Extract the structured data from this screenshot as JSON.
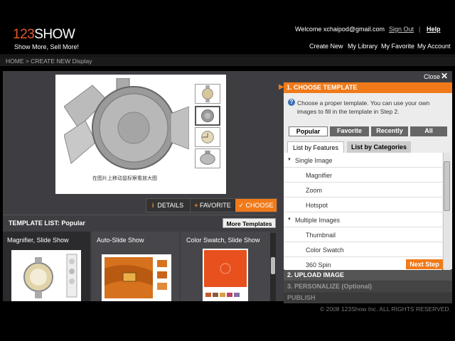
{
  "header": {
    "logo_num": "123",
    "logo_text": "SHOW",
    "tagline": "Show More, Sell More!",
    "welcome": "Welcome xchaipod@gmail.com",
    "sign_out": "Sign Out",
    "separator": "|",
    "help": "Help",
    "nav": [
      "Create New",
      "My Library",
      "My Favorite",
      "My Account"
    ]
  },
  "breadcrumb": "HOME > CREATE NEW Display",
  "preview": {
    "caption": "在图片上移动鼠标察看放大图"
  },
  "actions": {
    "details_icon": "i",
    "details": "DETAILS",
    "favorite_icon": "+",
    "favorite": "FAVORITE",
    "choose_icon": "✓",
    "choose": "CHOOSE"
  },
  "template_list": {
    "title": "TEMPLATE LIST: Popular",
    "more": "More Templates",
    "items": [
      "Magnifier, Slide Show",
      "Auto-Slide Show",
      "Color Swatch, Slide Show"
    ]
  },
  "right_panel": {
    "close": "Close",
    "close_icon": "✕",
    "step_arrow": "▶",
    "step1": "1. CHOOSE TEMPLATE",
    "info_icon": "?",
    "info": "Choose a proper template. You can use your own images to fill in the template in Step 2.",
    "tabs": [
      "Popular",
      "Favorite",
      "Recently",
      "All"
    ],
    "list_tabs": [
      "List by Features",
      "List by Categories"
    ],
    "caret": "▼",
    "list": [
      {
        "label": "Single Image",
        "kind": "cat"
      },
      {
        "label": "Magnifier",
        "kind": "sub"
      },
      {
        "label": "Zoom",
        "kind": "sub"
      },
      {
        "label": "Hotspot",
        "kind": "sub"
      },
      {
        "label": "Multiple Images",
        "kind": "cat"
      },
      {
        "label": "Thumbnail",
        "kind": "sub"
      },
      {
        "label": "Color Swatch",
        "kind": "sub"
      },
      {
        "label": "360 Spin",
        "kind": "sub"
      }
    ],
    "next": "Next Step",
    "step2": "2. UPLOAD IMAGE",
    "step3": "3. PERSONALIZE (Optional)",
    "step4": "PUBLISH"
  },
  "footer": "© 2008 123Show Inc. ALL RIGHTS RESERVED.",
  "colors": {
    "accent": "#f07a1a",
    "panel": "#3e3e42",
    "bg": "#000000"
  }
}
